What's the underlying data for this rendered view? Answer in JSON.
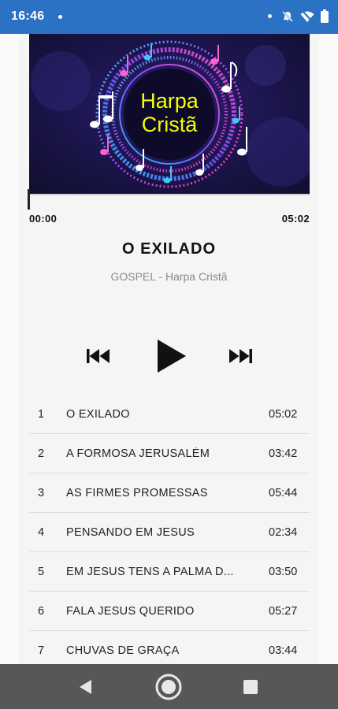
{
  "status_bar": {
    "time": "16:46"
  },
  "cover": {
    "line1": "Harpa",
    "line2": "Cristã"
  },
  "player": {
    "elapsed": "00:00",
    "total": "05:02",
    "progress": 0,
    "title": "O EXILADO",
    "subtitle": "GOSPEL - Harpa Cristã"
  },
  "playlist": [
    {
      "num": "1",
      "title": "O EXILADO",
      "duration": "05:02"
    },
    {
      "num": "2",
      "title": "A FORMOSA JERUSALÉM",
      "duration": "03:42"
    },
    {
      "num": "3",
      "title": "AS FIRMES PROMESSAS",
      "duration": "05:44"
    },
    {
      "num": "4",
      "title": "PENSANDO EM JESUS",
      "duration": "02:34"
    },
    {
      "num": "5",
      "title": "EM JESUS TENS A PALMA D...",
      "duration": "03:50"
    },
    {
      "num": "6",
      "title": "FALA JESUS QUERIDO",
      "duration": "05:27"
    },
    {
      "num": "7",
      "title": "CHUVAS DE GRAÇA",
      "duration": "03:44"
    }
  ],
  "colors": {
    "status_bar": "#2c72c4",
    "nav_bar": "#575757",
    "cover_text": "#f5ff00"
  }
}
